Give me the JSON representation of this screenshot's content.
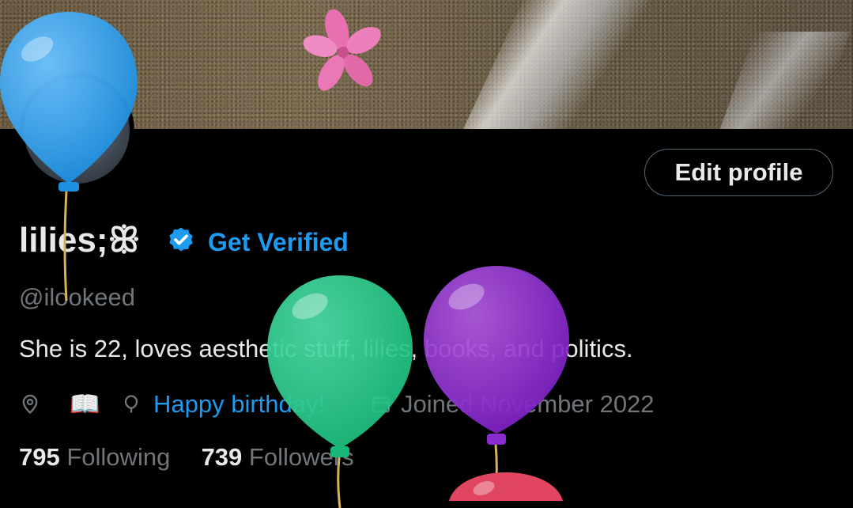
{
  "profile": {
    "display_name": "lilies;ꕥ",
    "get_verified": "Get Verified",
    "handle": "@ilookeed",
    "bio": "She is 22, loves aesthetic stuff, lilies, books, and politics.",
    "location_icon": "location-pin-icon",
    "book_emoji": "📖",
    "birthday_text": "Happy birthday!",
    "joined_text": "Joined November 2022"
  },
  "actions": {
    "edit_profile": "Edit profile"
  },
  "stats": {
    "following_count": "795",
    "following_label": "Following",
    "followers_count": "739",
    "followers_label": "Followers"
  },
  "colors": {
    "accent": "#1d9bf0",
    "text_primary": "#e7e9ea",
    "text_secondary": "#71767b",
    "background": "#000000"
  }
}
